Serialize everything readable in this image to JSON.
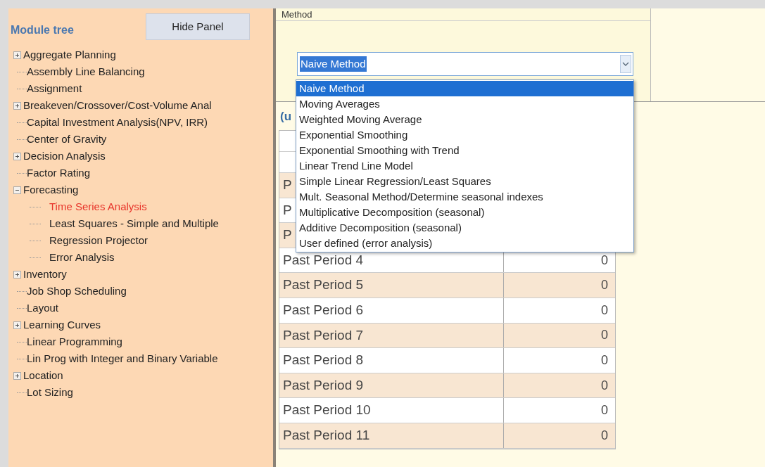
{
  "module_tree": {
    "title": "Module tree",
    "hide_button": "Hide Panel",
    "items": [
      {
        "label": "Aggregate Planning",
        "expanded": false,
        "selected": false
      },
      {
        "label": "Assembly Line Balancing",
        "selected": false
      },
      {
        "label": "Assignment",
        "selected": false
      },
      {
        "label": "Breakeven/Crossover/Cost-Volume Anal",
        "expanded": false,
        "selected": false
      },
      {
        "label": "Capital Investment Analysis(NPV, IRR)",
        "selected": false
      },
      {
        "label": "Center of Gravity",
        "selected": false
      },
      {
        "label": "Decision Analysis",
        "expanded": false,
        "selected": false
      },
      {
        "label": "Factor Rating",
        "selected": false
      },
      {
        "label": "Forecasting",
        "expanded": true,
        "selected": false,
        "children": [
          {
            "label": "Time Series Analysis",
            "selected": true
          },
          {
            "label": "Least Squares - Simple and Multiple",
            "selected": false
          },
          {
            "label": "Regression Projector",
            "selected": false
          },
          {
            "label": "Error Analysis",
            "selected": false
          }
        ]
      },
      {
        "label": "Inventory",
        "expanded": false,
        "selected": false
      },
      {
        "label": "Job Shop Scheduling",
        "selected": false
      },
      {
        "label": "Layout",
        "selected": false
      },
      {
        "label": "Learning Curves",
        "expanded": false,
        "selected": false
      },
      {
        "label": "Linear Programming",
        "selected": false
      },
      {
        "label": "Lin Prog with Integer and Binary Variable",
        "selected": false
      },
      {
        "label": "Location",
        "expanded": false,
        "selected": false
      },
      {
        "label": "Lot Sizing",
        "selected": false
      }
    ]
  },
  "method": {
    "label": "Method",
    "value": "Naive Method",
    "options": [
      {
        "label": "Naive Method",
        "selected": true
      },
      {
        "label": "Moving Averages",
        "selected": false
      },
      {
        "label": "Weighted Moving Average",
        "selected": false
      },
      {
        "label": "Exponential Smoothing",
        "selected": false
      },
      {
        "label": "Exponential Smoothing with Trend",
        "selected": false
      },
      {
        "label": "Linear Trend Line Model",
        "selected": false
      },
      {
        "label": "Simple Linear Regression/Least Squares",
        "selected": false
      },
      {
        "label": "Mult. Seasonal Method/Determine seasonal indexes",
        "selected": false
      },
      {
        "label": "Multiplicative Decomposition (seasonal)",
        "selected": false
      },
      {
        "label": "Additive Decomposition (seasonal)",
        "selected": false
      },
      {
        "label": "User defined (error analysis)",
        "selected": false
      }
    ]
  },
  "data_heading": "(u",
  "table": {
    "rows": [
      {
        "label": "P"
      },
      {
        "label": "P"
      },
      {
        "label": "P"
      },
      {
        "label": "Past Period 4",
        "value": "0"
      },
      {
        "label": "Past Period 5",
        "value": "0"
      },
      {
        "label": "Past Period 6",
        "value": "0"
      },
      {
        "label": "Past Period 7",
        "value": "0"
      },
      {
        "label": "Past Period 8",
        "value": "0"
      },
      {
        "label": "Past Period 9",
        "value": "0"
      },
      {
        "label": "Past Period 10",
        "value": "0"
      },
      {
        "label": "Past Period 11",
        "value": "0"
      }
    ]
  }
}
